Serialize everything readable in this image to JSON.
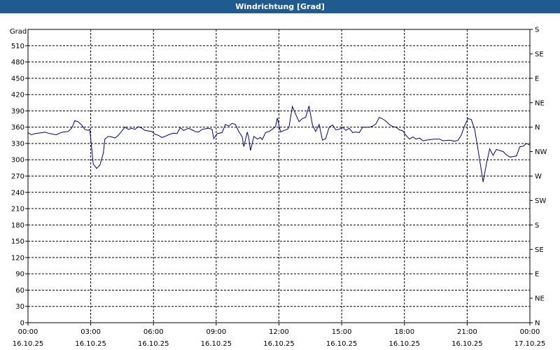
{
  "title": "Windrichtung [Grad]",
  "chart_data": {
    "type": "line",
    "title": "Windrichtung [Grad]",
    "ylabel": "Grad",
    "ylim": [
      0,
      540
    ],
    "yticks": [
      0,
      30,
      60,
      90,
      120,
      150,
      180,
      210,
      240,
      270,
      300,
      330,
      360,
      390,
      420,
      450,
      480,
      510
    ],
    "y2_labels": [
      {
        "value": 540,
        "label": "S"
      },
      {
        "value": 495,
        "label": "SE"
      },
      {
        "value": 450,
        "label": "E"
      },
      {
        "value": 405,
        "label": "NE"
      },
      {
        "value": 360,
        "label": "N"
      },
      {
        "value": 315,
        "label": "NW"
      },
      {
        "value": 270,
        "label": "W"
      },
      {
        "value": 225,
        "label": "SW"
      },
      {
        "value": 180,
        "label": "S"
      },
      {
        "value": 135,
        "label": "SE"
      },
      {
        "value": 90,
        "label": "E"
      },
      {
        "value": 45,
        "label": "NE"
      },
      {
        "value": 0,
        "label": "N"
      }
    ],
    "xlim_hours": [
      0,
      24
    ],
    "xticks": [
      {
        "hour": 0,
        "time": "00:00",
        "date": "16.10.25"
      },
      {
        "hour": 3,
        "time": "03:00",
        "date": "16.10.25"
      },
      {
        "hour": 6,
        "time": "06:00",
        "date": "16.10.25"
      },
      {
        "hour": 9,
        "time": "09:00",
        "date": "16.10.25"
      },
      {
        "hour": 12,
        "time": "12:00",
        "date": "16.10.25"
      },
      {
        "hour": 15,
        "time": "15:00",
        "date": "16.10.25"
      },
      {
        "hour": 18,
        "time": "18:00",
        "date": "16.10.25"
      },
      {
        "hour": 21,
        "time": "21:00",
        "date": "16.10.25"
      },
      {
        "hour": 24,
        "time": "00:00",
        "date": "17.10.25"
      }
    ],
    "grid": true,
    "series": [
      {
        "color": "#00008b",
        "points": [
          [
            0.0,
            350
          ],
          [
            0.17,
            346
          ],
          [
            0.33,
            348
          ],
          [
            0.5,
            349
          ],
          [
            0.75,
            350
          ],
          [
            0.83,
            351
          ],
          [
            1.0,
            349
          ],
          [
            1.25,
            347
          ],
          [
            1.42,
            346
          ],
          [
            1.58,
            349
          ],
          [
            1.75,
            351
          ],
          [
            2.0,
            352
          ],
          [
            2.17,
            358
          ],
          [
            2.25,
            364
          ],
          [
            2.33,
            372
          ],
          [
            2.5,
            370
          ],
          [
            2.67,
            364
          ],
          [
            2.83,
            356
          ],
          [
            3.0,
            354
          ],
          [
            3.08,
            356
          ],
          [
            3.17,
            322
          ],
          [
            3.25,
            292
          ],
          [
            3.42,
            284
          ],
          [
            3.58,
            290
          ],
          [
            3.75,
            312
          ],
          [
            3.83,
            338
          ],
          [
            4.0,
            343
          ],
          [
            4.17,
            342
          ],
          [
            4.33,
            340
          ],
          [
            4.5,
            345
          ],
          [
            4.83,
            360
          ],
          [
            5.0,
            356
          ],
          [
            5.17,
            358
          ],
          [
            5.33,
            356
          ],
          [
            5.5,
            361
          ],
          [
            5.67,
            358
          ],
          [
            5.83,
            354
          ],
          [
            6.0,
            353
          ],
          [
            6.17,
            352
          ],
          [
            6.33,
            347
          ],
          [
            6.5,
            345
          ],
          [
            6.67,
            341
          ],
          [
            6.83,
            343
          ],
          [
            7.0,
            346
          ],
          [
            7.25,
            349
          ],
          [
            7.42,
            348
          ],
          [
            7.58,
            359
          ],
          [
            7.75,
            354
          ],
          [
            8.0,
            358
          ],
          [
            8.17,
            355
          ],
          [
            8.33,
            352
          ],
          [
            8.5,
            351
          ],
          [
            8.67,
            356
          ],
          [
            8.83,
            357
          ],
          [
            9.0,
            358
          ],
          [
            9.17,
            356
          ],
          [
            9.25,
            339
          ],
          [
            9.42,
            348
          ],
          [
            9.67,
            350
          ],
          [
            9.83,
            365
          ],
          [
            10.0,
            362
          ],
          [
            10.17,
            367
          ],
          [
            10.33,
            365
          ],
          [
            10.5,
            352
          ],
          [
            10.67,
            342
          ],
          [
            10.75,
            324
          ],
          [
            10.92,
            351
          ],
          [
            11.0,
            340
          ],
          [
            11.08,
            317
          ],
          [
            11.25,
            343
          ],
          [
            11.42,
            338
          ],
          [
            11.58,
            341
          ],
          [
            11.67,
            337
          ],
          [
            11.83,
            350
          ],
          [
            12.0,
            352
          ],
          [
            12.17,
            356
          ],
          [
            12.33,
            361
          ],
          [
            12.42,
            377
          ],
          [
            12.58,
            351
          ],
          [
            12.75,
            354
          ],
          [
            12.92,
            356
          ],
          [
            13.0,
            360
          ],
          [
            13.17,
            398
          ],
          [
            13.33,
            384
          ],
          [
            13.5,
            370
          ],
          [
            13.67,
            376
          ],
          [
            13.83,
            378
          ],
          [
            14.0,
            399
          ],
          [
            14.17,
            364
          ],
          [
            14.33,
            352
          ],
          [
            14.5,
            365
          ],
          [
            14.67,
            336
          ],
          [
            14.83,
            339
          ],
          [
            15.0,
            360
          ],
          [
            15.17,
            364
          ],
          [
            15.33,
            355
          ],
          [
            15.5,
            356
          ],
          [
            15.67,
            360
          ],
          [
            15.83,
            354
          ],
          [
            16.0,
            358
          ],
          [
            16.17,
            350
          ],
          [
            16.33,
            351
          ],
          [
            16.5,
            350
          ],
          [
            16.67,
            360
          ],
          [
            16.83,
            360
          ],
          [
            17.0,
            360
          ],
          [
            17.17,
            362
          ],
          [
            17.33,
            366
          ],
          [
            17.5,
            378
          ],
          [
            17.67,
            375
          ],
          [
            17.83,
            371
          ],
          [
            18.0,
            365
          ],
          [
            18.17,
            361
          ],
          [
            18.33,
            360
          ],
          [
            18.5,
            355
          ],
          [
            18.67,
            353
          ],
          [
            18.83,
            345
          ],
          [
            19.0,
            338
          ],
          [
            19.17,
            342
          ],
          [
            19.33,
            338
          ],
          [
            19.5,
            340
          ],
          [
            19.67,
            335
          ],
          [
            19.83,
            336
          ],
          [
            20.0,
            337
          ],
          [
            20.25,
            338
          ],
          [
            20.5,
            338
          ],
          [
            20.67,
            335
          ],
          [
            21.0,
            336
          ],
          [
            21.25,
            334
          ],
          [
            21.42,
            336
          ],
          [
            21.58,
            345
          ],
          [
            21.75,
            363
          ],
          [
            21.92,
            376
          ],
          [
            22.08,
            374
          ],
          [
            22.25,
            356
          ],
          [
            22.42,
            318
          ],
          [
            22.67,
            259
          ],
          [
            22.83,
            292
          ],
          [
            23.0,
            320
          ],
          [
            23.17,
            308
          ],
          [
            23.33,
            319
          ],
          [
            23.5,
            317
          ],
          [
            23.67,
            315
          ],
          [
            23.83,
            309
          ],
          [
            24.0,
            305
          ],
          [
            24.17,
            306
          ],
          [
            24.33,
            307
          ],
          [
            24.5,
            324
          ],
          [
            24.67,
            325
          ],
          [
            24.83,
            330
          ],
          [
            25.0,
            327
          ]
        ]
      }
    ]
  }
}
